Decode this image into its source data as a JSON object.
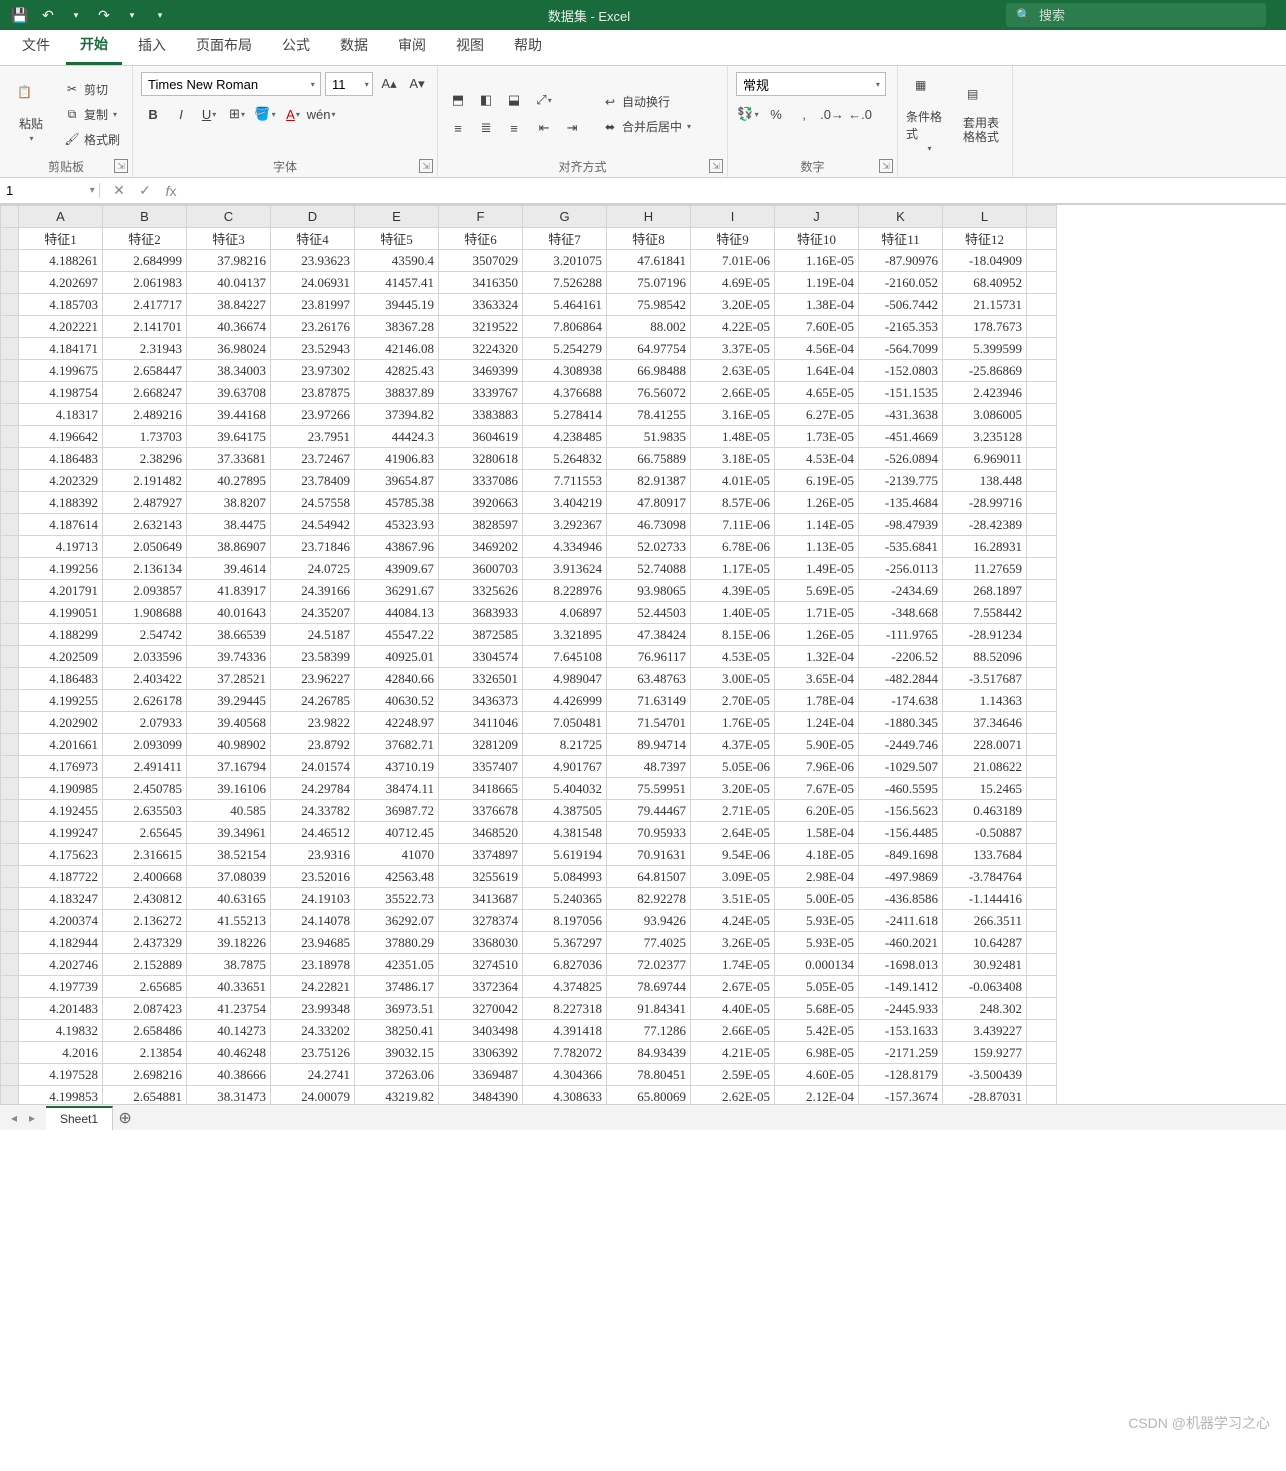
{
  "titlebar": {
    "title": "数据集  -  Excel",
    "search_placeholder": "搜索"
  },
  "tabs": {
    "file": "文件",
    "home": "开始",
    "insert": "插入",
    "layout": "页面布局",
    "formulas": "公式",
    "data": "数据",
    "review": "审阅",
    "view": "视图",
    "help": "帮助"
  },
  "ribbon": {
    "clipboard": {
      "paste": "粘贴",
      "cut": "剪切",
      "copy": "复制",
      "format_painter": "格式刷",
      "group": "剪贴板"
    },
    "font": {
      "family": "Times New Roman",
      "size": "11",
      "wen": "wén",
      "group": "字体"
    },
    "alignment": {
      "wrap": "自动换行",
      "merge": "合并后居中",
      "group": "对齐方式"
    },
    "number": {
      "format": "常规",
      "group": "数字"
    },
    "styles": {
      "cond": "条件格式",
      "table": "套用表格格式"
    }
  },
  "namebox": "1",
  "formula": "",
  "columns": [
    "A",
    "B",
    "C",
    "D",
    "E",
    "F",
    "G",
    "H",
    "I",
    "J",
    "K",
    "L"
  ],
  "headers": [
    "特征1",
    "特征2",
    "特征3",
    "特征4",
    "特征5",
    "特征6",
    "特征7",
    "特征8",
    "特征9",
    "特征10",
    "特征11",
    "特征12"
  ],
  "rows": [
    [
      "4.188261",
      "2.684999",
      "37.98216",
      "23.93623",
      "43590.4",
      "3507029",
      "3.201075",
      "47.61841",
      "7.01E-06",
      "1.16E-05",
      "-87.90976",
      "-18.04909"
    ],
    [
      "4.202697",
      "2.061983",
      "40.04137",
      "24.06931",
      "41457.41",
      "3416350",
      "7.526288",
      "75.07196",
      "4.69E-05",
      "1.19E-04",
      "-2160.052",
      "68.40952"
    ],
    [
      "4.185703",
      "2.417717",
      "38.84227",
      "23.81997",
      "39445.19",
      "3363324",
      "5.464161",
      "75.98542",
      "3.20E-05",
      "1.38E-04",
      "-506.7442",
      "21.15731"
    ],
    [
      "4.202221",
      "2.141701",
      "40.36674",
      "23.26176",
      "38367.28",
      "3219522",
      "7.806864",
      "88.002",
      "4.22E-05",
      "7.60E-05",
      "-2165.353",
      "178.7673"
    ],
    [
      "4.184171",
      "2.31943",
      "36.98024",
      "23.52943",
      "42146.08",
      "3224320",
      "5.254279",
      "64.97754",
      "3.37E-05",
      "4.56E-04",
      "-564.7099",
      "5.399599"
    ],
    [
      "4.199675",
      "2.658447",
      "38.34003",
      "23.97302",
      "42825.43",
      "3469399",
      "4.308938",
      "66.98488",
      "2.63E-05",
      "1.64E-04",
      "-152.0803",
      "-25.86869"
    ],
    [
      "4.198754",
      "2.668247",
      "39.63708",
      "23.87875",
      "38837.89",
      "3339767",
      "4.376688",
      "76.56072",
      "2.66E-05",
      "4.65E-05",
      "-151.1535",
      "2.423946"
    ],
    [
      "4.18317",
      "2.489216",
      "39.44168",
      "23.97266",
      "37394.82",
      "3383883",
      "5.278414",
      "78.41255",
      "3.16E-05",
      "6.27E-05",
      "-431.3638",
      "3.086005"
    ],
    [
      "4.196642",
      "1.73703",
      "39.64175",
      "23.7951",
      "44424.3",
      "3604619",
      "4.238485",
      "51.9835",
      "1.48E-05",
      "1.73E-05",
      "-451.4669",
      "3.235128"
    ],
    [
      "4.186483",
      "2.38296",
      "37.33681",
      "23.72467",
      "41906.83",
      "3280618",
      "5.264832",
      "66.75889",
      "3.18E-05",
      "4.53E-04",
      "-526.0894",
      "6.969011"
    ],
    [
      "4.202329",
      "2.191482",
      "40.27895",
      "23.78409",
      "39654.87",
      "3337086",
      "7.711553",
      "82.91387",
      "4.01E-05",
      "6.19E-05",
      "-2139.775",
      "138.448"
    ],
    [
      "4.188392",
      "2.487927",
      "38.8207",
      "24.57558",
      "45785.38",
      "3920663",
      "3.404219",
      "47.80917",
      "8.57E-06",
      "1.26E-05",
      "-135.4684",
      "-28.99716"
    ],
    [
      "4.187614",
      "2.632143",
      "38.4475",
      "24.54942",
      "45323.93",
      "3828597",
      "3.292367",
      "46.73098",
      "7.11E-06",
      "1.14E-05",
      "-98.47939",
      "-28.42389"
    ],
    [
      "4.19713",
      "2.050649",
      "38.86907",
      "23.71846",
      "43867.96",
      "3469202",
      "4.334946",
      "52.02733",
      "6.78E-06",
      "1.13E-05",
      "-535.6841",
      "16.28931"
    ],
    [
      "4.199256",
      "2.136134",
      "39.4614",
      "24.0725",
      "43909.67",
      "3600703",
      "3.913624",
      "52.74088",
      "1.17E-05",
      "1.49E-05",
      "-256.0113",
      "11.27659"
    ],
    [
      "4.201791",
      "2.093857",
      "41.83917",
      "24.39166",
      "36291.67",
      "3325626",
      "8.228976",
      "93.98065",
      "4.39E-05",
      "5.69E-05",
      "-2434.69",
      "268.1897"
    ],
    [
      "4.199051",
      "1.908688",
      "40.01643",
      "24.35207",
      "44084.13",
      "3683933",
      "4.06897",
      "52.44503",
      "1.40E-05",
      "1.71E-05",
      "-348.668",
      "7.558442"
    ],
    [
      "4.188299",
      "2.54742",
      "38.66539",
      "24.5187",
      "45547.22",
      "3872585",
      "3.321895",
      "47.38424",
      "8.15E-06",
      "1.26E-05",
      "-111.9765",
      "-28.91234"
    ],
    [
      "4.202509",
      "2.033596",
      "39.74336",
      "23.58399",
      "40925.01",
      "3304574",
      "7.645108",
      "76.96117",
      "4.53E-05",
      "1.32E-04",
      "-2206.52",
      "88.52096"
    ],
    [
      "4.186483",
      "2.403422",
      "37.28521",
      "23.96227",
      "42840.66",
      "3326501",
      "4.989047",
      "63.48763",
      "3.00E-05",
      "3.65E-04",
      "-482.2844",
      "-3.517687"
    ],
    [
      "4.199255",
      "2.626178",
      "39.29445",
      "24.26785",
      "40630.52",
      "3436373",
      "4.426999",
      "71.63149",
      "2.70E-05",
      "1.78E-04",
      "-174.638",
      "1.14363"
    ],
    [
      "4.202902",
      "2.07933",
      "39.40568",
      "23.9822",
      "42248.97",
      "3411046",
      "7.050481",
      "71.54701",
      "1.76E-05",
      "1.24E-04",
      "-1880.345",
      "37.34646"
    ],
    [
      "4.201661",
      "2.093099",
      "40.98902",
      "23.8792",
      "37682.71",
      "3281209",
      "8.21725",
      "89.94714",
      "4.37E-05",
      "5.90E-05",
      "-2449.746",
      "228.0071"
    ],
    [
      "4.176973",
      "2.491411",
      "37.16794",
      "24.01574",
      "43710.19",
      "3357407",
      "4.901767",
      "48.7397",
      "5.05E-06",
      "7.96E-06",
      "-1029.507",
      "21.08622"
    ],
    [
      "4.190985",
      "2.450785",
      "39.16106",
      "24.29784",
      "38474.11",
      "3418665",
      "5.404032",
      "75.59951",
      "3.20E-05",
      "7.67E-05",
      "-460.5595",
      "15.2465"
    ],
    [
      "4.192455",
      "2.635503",
      "40.585",
      "24.33782",
      "36987.72",
      "3376678",
      "4.387505",
      "79.44467",
      "2.71E-05",
      "6.20E-05",
      "-156.5623",
      "0.463189"
    ],
    [
      "4.199247",
      "2.65645",
      "39.34961",
      "24.46512",
      "40712.45",
      "3468520",
      "4.381548",
      "70.95933",
      "2.64E-05",
      "1.58E-04",
      "-156.4485",
      "-0.50887"
    ],
    [
      "4.175623",
      "2.316615",
      "38.52154",
      "23.9316",
      "41070",
      "3374897",
      "5.619194",
      "70.91631",
      "9.54E-06",
      "4.18E-05",
      "-849.1698",
      "133.7684"
    ],
    [
      "4.187722",
      "2.400668",
      "37.08039",
      "23.52016",
      "42563.48",
      "3255619",
      "5.084993",
      "64.81507",
      "3.09E-05",
      "2.98E-04",
      "-497.9869",
      "-3.784764"
    ],
    [
      "4.183247",
      "2.430812",
      "40.63165",
      "24.19103",
      "35522.73",
      "3413687",
      "5.240365",
      "82.92278",
      "3.51E-05",
      "5.00E-05",
      "-436.8586",
      "-1.144416"
    ],
    [
      "4.200374",
      "2.136272",
      "41.55213",
      "24.14078",
      "36292.07",
      "3278374",
      "8.197056",
      "93.9426",
      "4.24E-05",
      "5.93E-05",
      "-2411.618",
      "266.3511"
    ],
    [
      "4.182944",
      "2.437329",
      "39.18226",
      "23.94685",
      "37880.29",
      "3368030",
      "5.367297",
      "77.4025",
      "3.26E-05",
      "5.93E-05",
      "-460.2021",
      "10.64287"
    ],
    [
      "4.202746",
      "2.152889",
      "38.7875",
      "23.18978",
      "42351.05",
      "3274510",
      "6.827036",
      "72.02377",
      "1.74E-05",
      "0.000134",
      "-1698.013",
      "30.92481"
    ],
    [
      "4.197739",
      "2.65685",
      "40.33651",
      "24.22821",
      "37486.17",
      "3372364",
      "4.374825",
      "78.69744",
      "2.67E-05",
      "5.05E-05",
      "-149.1412",
      "-0.063408"
    ],
    [
      "4.201483",
      "2.087423",
      "41.23754",
      "23.99348",
      "36973.51",
      "3270042",
      "8.227318",
      "91.84341",
      "4.40E-05",
      "5.68E-05",
      "-2445.933",
      "248.302"
    ],
    [
      "4.19832",
      "2.658486",
      "40.14273",
      "24.33202",
      "38250.41",
      "3403498",
      "4.391418",
      "77.1286",
      "2.66E-05",
      "5.42E-05",
      "-153.1633",
      "3.439227"
    ],
    [
      "4.2016",
      "2.13854",
      "40.46248",
      "23.75126",
      "39032.15",
      "3306392",
      "7.782072",
      "84.93439",
      "4.21E-05",
      "6.98E-05",
      "-2171.259",
      "159.9277"
    ],
    [
      "4.197528",
      "2.698216",
      "40.38666",
      "24.2741",
      "37263.06",
      "3369487",
      "4.304366",
      "78.80451",
      "2.59E-05",
      "4.60E-05",
      "-128.8179",
      "-3.500439"
    ],
    [
      "4.199853",
      "2.654881",
      "38.31473",
      "24.00079",
      "43219.82",
      "3484390",
      "4.308633",
      "65.80069",
      "2.62E-05",
      "2.12E-04",
      "-157.3674",
      "-28.87031"
    ]
  ],
  "sheet": {
    "name": "Sheet1"
  },
  "watermark": "CSDN @机器学习之心",
  "chart_data": {
    "type": "table",
    "note": "tabular data; no chart rendered"
  }
}
